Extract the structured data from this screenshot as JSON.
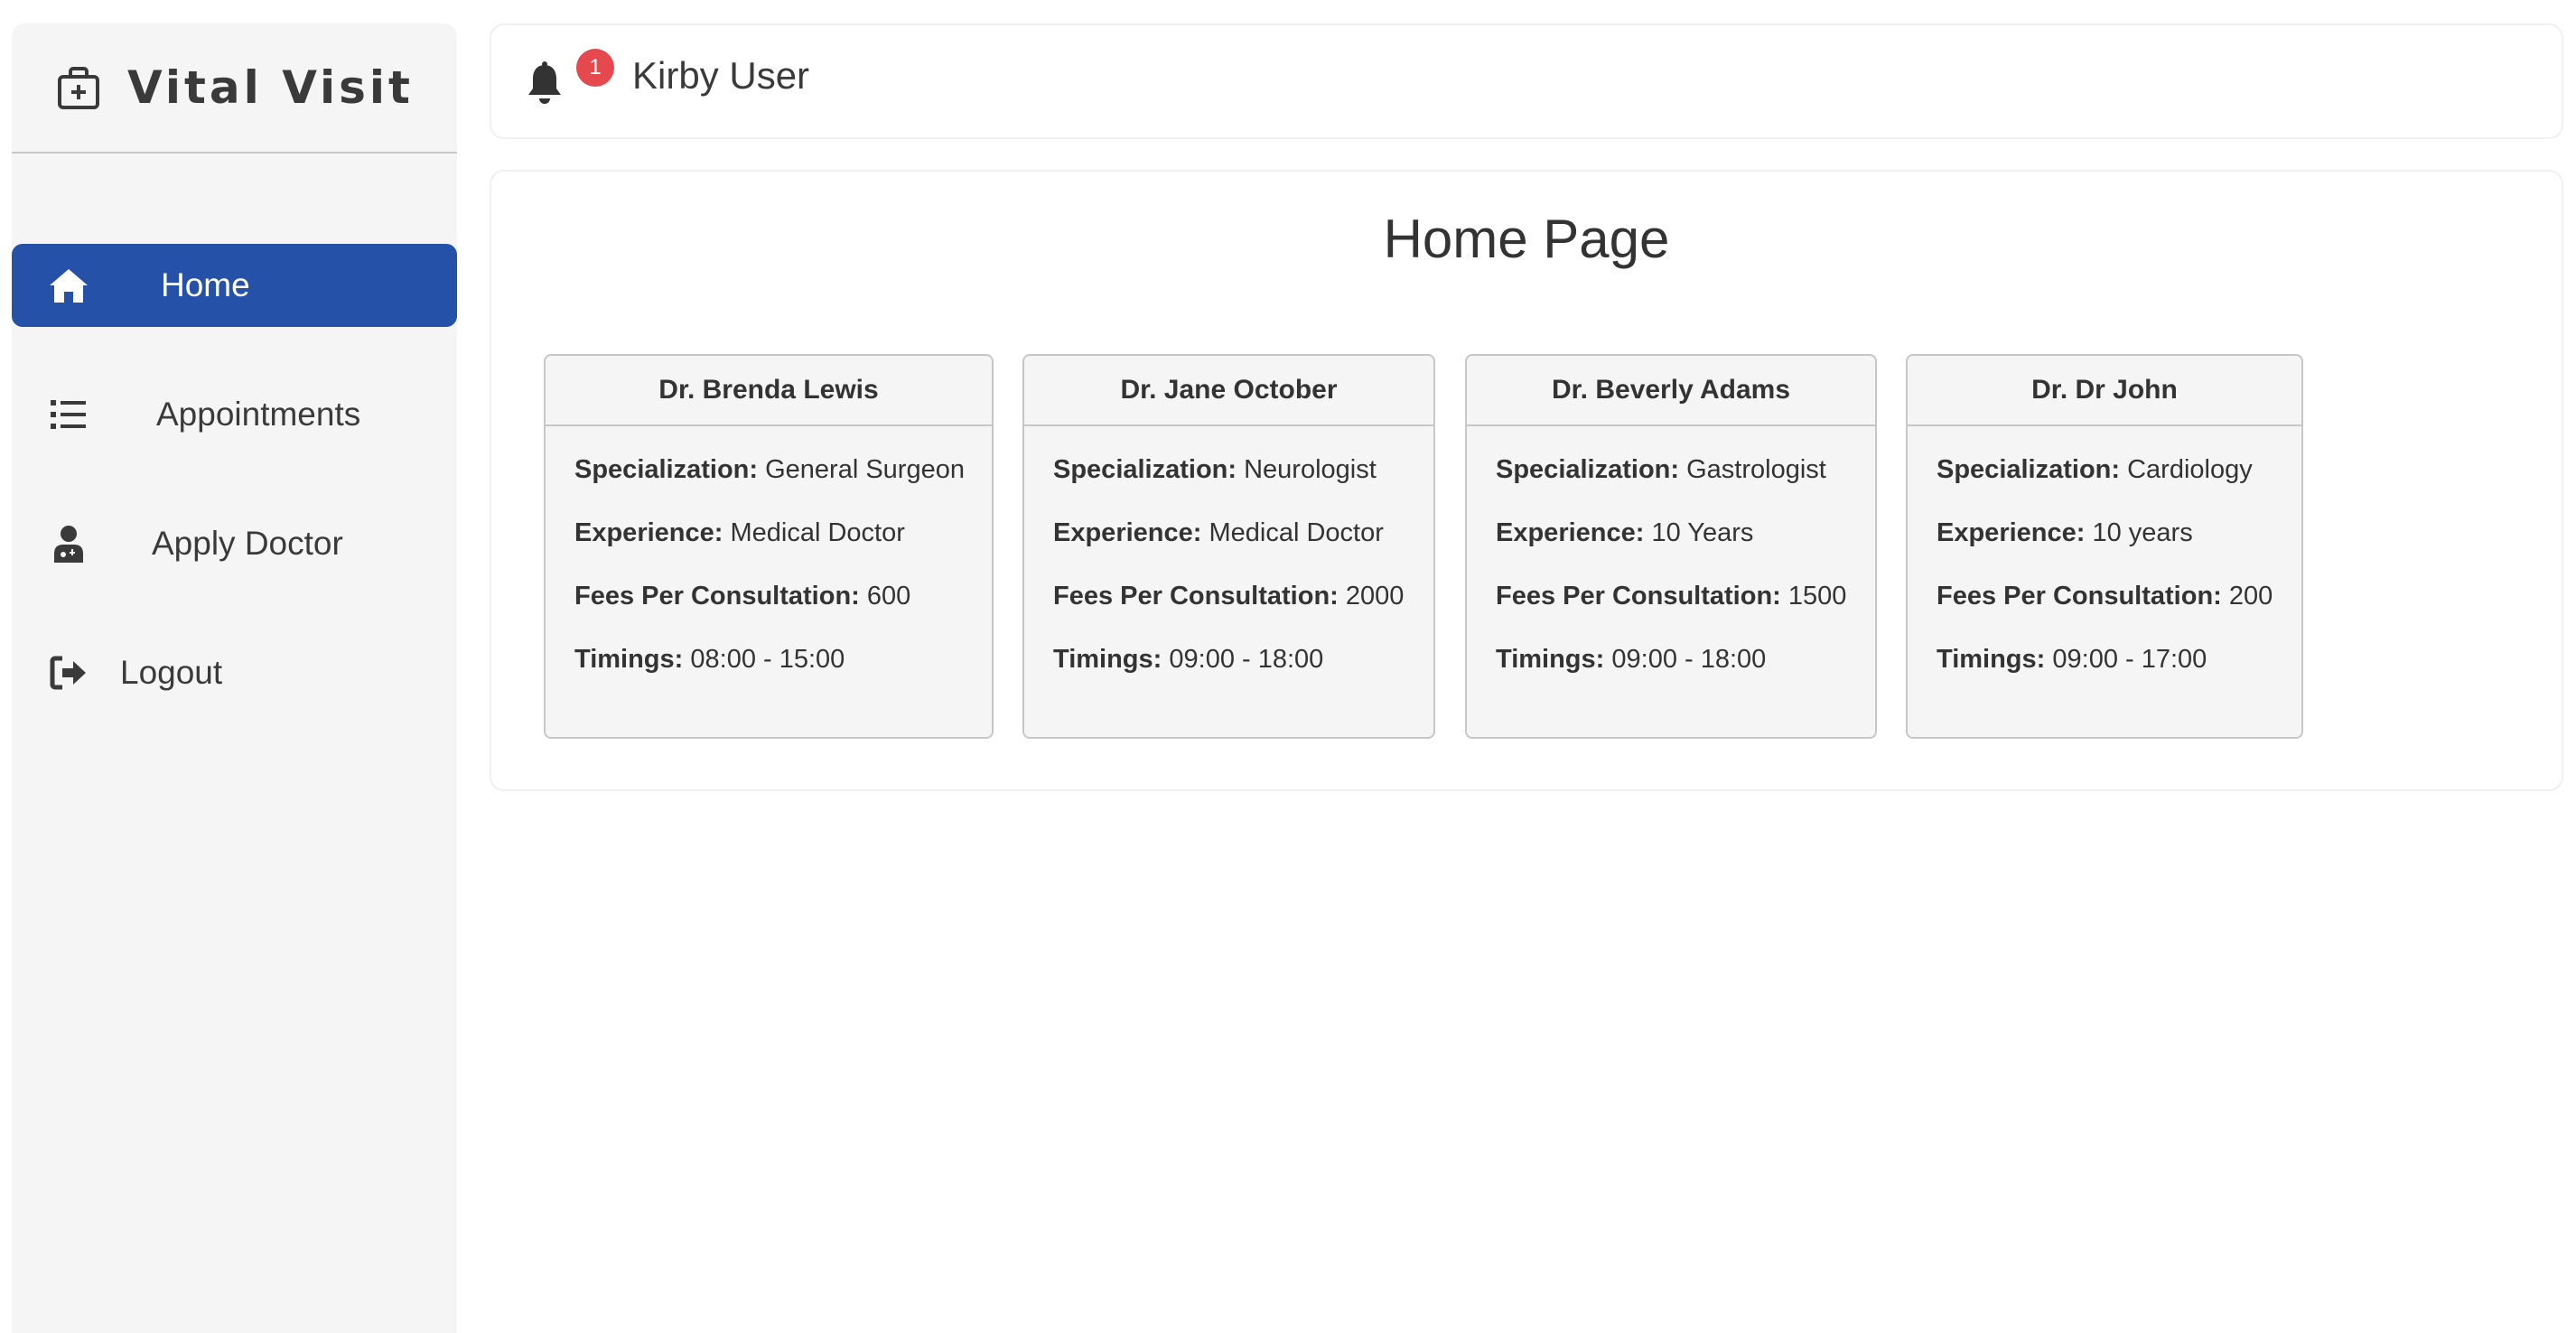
{
  "brand": {
    "name": "Vital Visit",
    "icon": "medical-kit-icon"
  },
  "sidebar": {
    "items": [
      {
        "label": "Home",
        "icon": "home-icon",
        "active": true
      },
      {
        "label": "Appointments",
        "icon": "list-icon",
        "active": false
      },
      {
        "label": "Apply Doctor",
        "icon": "doctor-icon",
        "active": false
      },
      {
        "label": "Logout",
        "icon": "logout-icon",
        "active": false
      }
    ]
  },
  "header": {
    "notification_count": "1",
    "user_name": "Kirby User"
  },
  "main": {
    "title": "Home Page",
    "labels": {
      "specialization": "Specialization:",
      "experience": "Experience:",
      "fees": "Fees Per Consultation:",
      "timings": "Timings:"
    },
    "doctors": [
      {
        "name": "Dr. Brenda Lewis",
        "specialization": "General Surgeon",
        "experience": "Medical Doctor",
        "fees": "600",
        "timings": "08:00 - 15:00"
      },
      {
        "name": "Dr. Jane October",
        "specialization": "Neurologist",
        "experience": "Medical Doctor",
        "fees": "2000",
        "timings": "09:00 - 18:00"
      },
      {
        "name": "Dr. Beverly Adams",
        "specialization": "Gastrologist",
        "experience": "10 Years",
        "fees": "1500",
        "timings": "09:00 - 18:00"
      },
      {
        "name": "Dr. Dr John",
        "specialization": "Cardiology",
        "experience": "10 years",
        "fees": "200",
        "timings": "09:00 - 17:00"
      }
    ]
  },
  "colors": {
    "accent": "#2651a8",
    "badge": "#e5484d",
    "sidebar_bg": "#f5f5f5",
    "card_bg": "#f5f5f5"
  }
}
